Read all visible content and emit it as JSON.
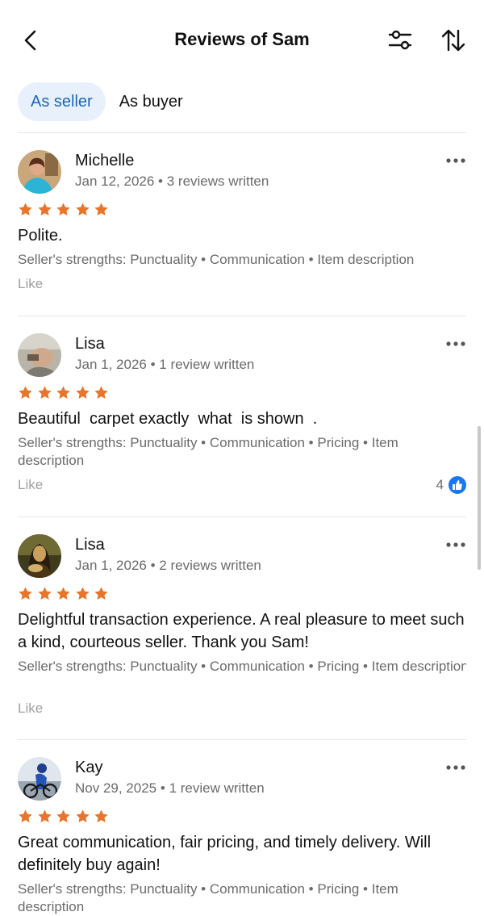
{
  "header": {
    "title": "Reviews of Sam"
  },
  "tabs": [
    {
      "label": "As seller",
      "active": true
    },
    {
      "label": "As buyer",
      "active": false
    }
  ],
  "colors": {
    "accent": "#1c66b8",
    "tab_bg": "#e8f1fb",
    "star": "#e8752a",
    "like_badge": "#1877f2"
  },
  "reviews": [
    {
      "name": "Michelle",
      "date": "Jan 12, 2026",
      "written": "3 reviews written",
      "rating": 5,
      "text": "Polite.",
      "strengths": "Seller's strengths: Punctuality • Communication • Item description",
      "like_label": "Like",
      "like_count": ""
    },
    {
      "name": "Lisa",
      "date": "Jan 1, 2026",
      "written": "1 review written",
      "rating": 5,
      "text": "Beautiful  carpet exactly  what  is shown  .",
      "strengths": "Seller's strengths: Punctuality • Communication • Pricing • Item description",
      "like_label": "Like",
      "like_count": "4"
    },
    {
      "name": "Lisa",
      "date": "Jan 1, 2026",
      "written": "2 reviews written",
      "rating": 5,
      "text": "Delightful transaction experience. A real pleasure to meet such a kind, courteous seller. Thank you Sam!",
      "strengths": "Seller's strengths: Punctuality • Communication • Pricing • Item description",
      "like_label": "Like",
      "like_count": ""
    },
    {
      "name": "Kay",
      "date": "Nov 29, 2025",
      "written": "1 review written",
      "rating": 5,
      "text": "Great communication, fair pricing, and timely delivery. Will definitely buy again!",
      "strengths": "Seller's strengths: Punctuality • Communication • Pricing • Item description",
      "like_label": "",
      "like_count": ""
    }
  ]
}
